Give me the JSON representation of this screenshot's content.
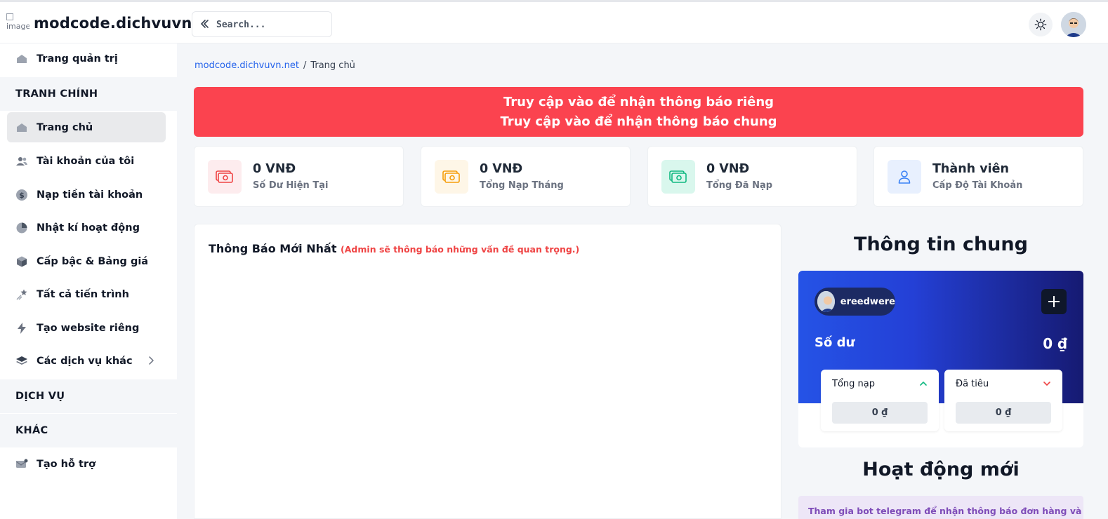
{
  "header": {
    "logo_alt": "image",
    "site_title": "modcode.dichvuvn.net",
    "search_placeholder": "Search..."
  },
  "sidebar": {
    "top_item": "Trang quản trị",
    "sections": [
      "TRANH CHÍNH",
      "DỊCH VỤ",
      "KHÁC"
    ],
    "items": [
      {
        "label": "Trang chủ",
        "icon": "home-icon",
        "active": true
      },
      {
        "label": "Tài khoản của tôi",
        "icon": "users-icon"
      },
      {
        "label": "Nạp tiền tài khoản",
        "icon": "dollar-icon"
      },
      {
        "label": "Nhật kí hoạt động",
        "icon": "pie-chart-icon"
      },
      {
        "label": "Cấp bậc & Bảng giá",
        "icon": "cube-icon"
      },
      {
        "label": "Tất cả tiến trình",
        "icon": "shooting-star-icon"
      },
      {
        "label": "Tạo website riêng",
        "icon": "bolt-icon"
      },
      {
        "label": "Các dịch vụ khác",
        "icon": "layers-icon"
      }
    ],
    "support_item": "Tạo hỗ trợ"
  },
  "breadcrumb": {
    "link": "modcode.dichvuvn.net",
    "separator": "/",
    "current": "Trang chủ"
  },
  "alert": {
    "line1": "Truy cập vào để nhận thông báo riêng",
    "line2": "Truy cập vào để nhận thông báo chung",
    "color": "#fb434f"
  },
  "stats": [
    {
      "value": "0 VNĐ",
      "label": "Số Dư Hiện Tại",
      "color": "#ef4444",
      "bg": "#fdecee"
    },
    {
      "value": "0 VNĐ",
      "label": "Tổng Nạp Tháng",
      "color": "#f59e0b",
      "bg": "#fef6e7"
    },
    {
      "value": "0 VNĐ",
      "label": "Tổng Đã Nạp",
      "color": "#10b981",
      "bg": "#d9f7ed"
    },
    {
      "value": "Thành viên",
      "label": "Cấp Độ Tài Khoản",
      "color": "#3b82f6",
      "bg": "#e8f0fe"
    }
  ],
  "notice": {
    "title": "Thông Báo Mới Nhất",
    "note": "(Admin sẽ thông báo những vấn đề quan trọng.)"
  },
  "info": {
    "title": "Thông tin chung",
    "username": "ereedwere",
    "balance_label": "Số dư",
    "balance_value": "0 ₫",
    "deposit_label": "Tổng nạp",
    "deposit_value": "0 ₫",
    "spent_label": "Đã tiêu",
    "spent_value": "0 ₫"
  },
  "activity": {
    "title": "Hoạt động mới",
    "note": "Tham gia bot telegram để nhận thông báo đơn hàng và hoat"
  }
}
